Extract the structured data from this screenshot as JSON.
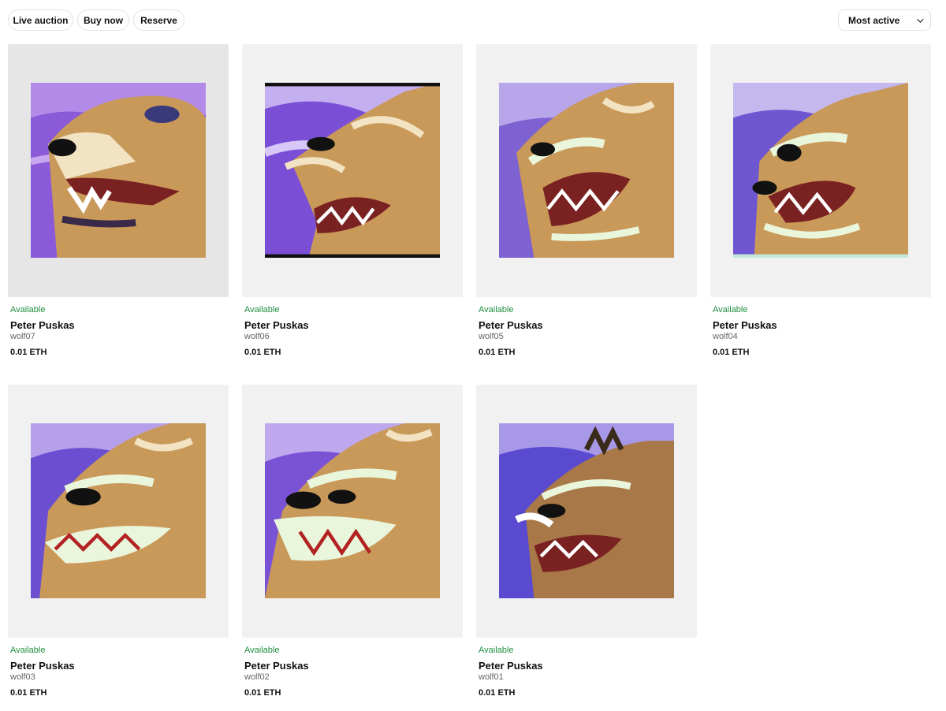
{
  "filters": {
    "live_auction": "Live auction",
    "buy_now": "Buy now",
    "reserve": "Reserve"
  },
  "sort": {
    "selected": "Most active"
  },
  "colors": {
    "status_green": "#1e8e3e",
    "card_bg": "#f1f1f1",
    "sky_purple": "#7a4fd6",
    "fur_tan": "#c9995a"
  },
  "cards": [
    {
      "status": "Available",
      "artist": "Peter Puskas",
      "title": "wolf07",
      "price": "0.01 ETH"
    },
    {
      "status": "Available",
      "artist": "Peter Puskas",
      "title": "wolf06",
      "price": "0.01 ETH"
    },
    {
      "status": "Available",
      "artist": "Peter Puskas",
      "title": "wolf05",
      "price": "0.01 ETH"
    },
    {
      "status": "Available",
      "artist": "Peter Puskas",
      "title": "wolf04",
      "price": "0.01 ETH"
    },
    {
      "status": "Available",
      "artist": "Peter Puskas",
      "title": "wolf03",
      "price": "0.01 ETH"
    },
    {
      "status": "Available",
      "artist": "Peter Puskas",
      "title": "wolf02",
      "price": "0.01 ETH"
    },
    {
      "status": "Available",
      "artist": "Peter Puskas",
      "title": "wolf01",
      "price": "0.01 ETH"
    }
  ]
}
